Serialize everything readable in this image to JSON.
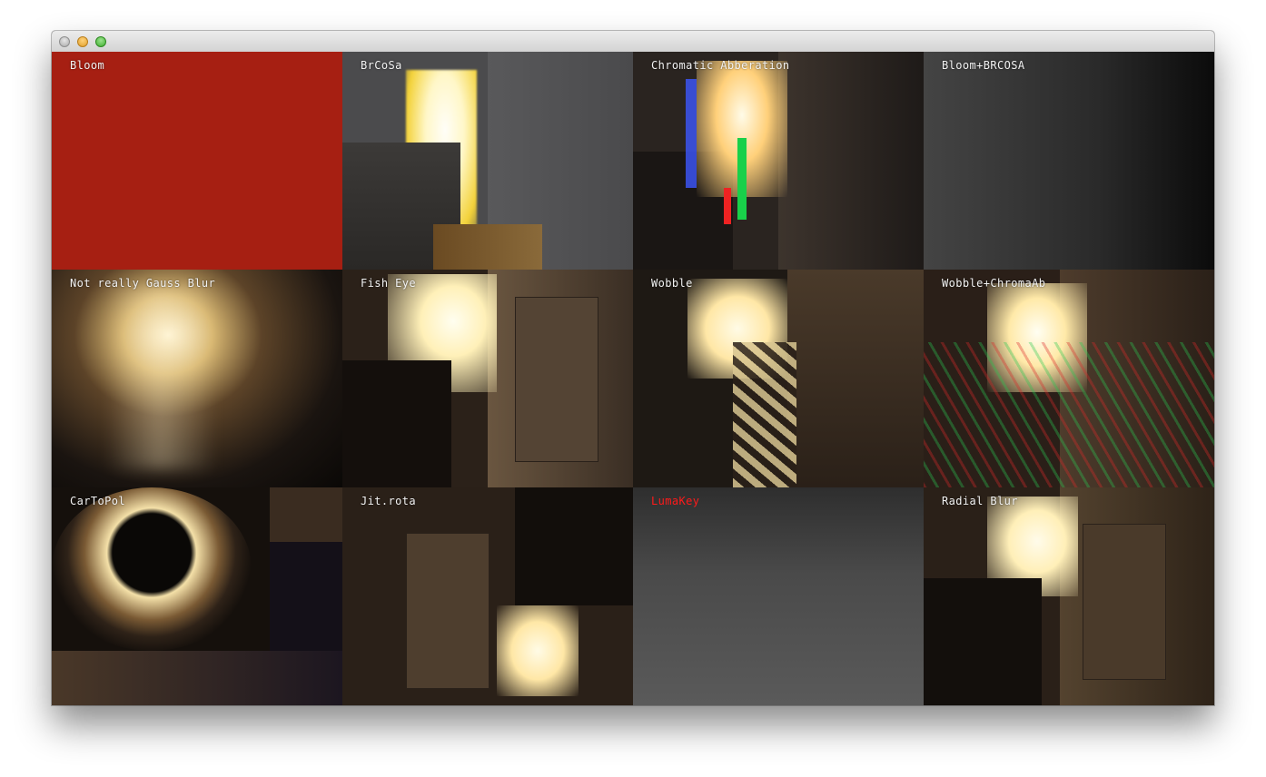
{
  "window": {
    "controls": [
      "close",
      "minimize",
      "maximize"
    ]
  },
  "cells": [
    {
      "label": "Bloom"
    },
    {
      "label": "BrCoSa"
    },
    {
      "label": "Chromatic Abberation"
    },
    {
      "label": "Bloom+BRCOSA"
    },
    {
      "label": "Not really Gauss Blur"
    },
    {
      "label": "Fish Eye"
    },
    {
      "label": "Wobble"
    },
    {
      "label": "Wobble+ChromaAb"
    },
    {
      "label": "CarToPol"
    },
    {
      "label": "Jit.rota"
    },
    {
      "label": "LumaKey",
      "color": "#ff1a1a"
    },
    {
      "label": "Radial Blur"
    }
  ]
}
